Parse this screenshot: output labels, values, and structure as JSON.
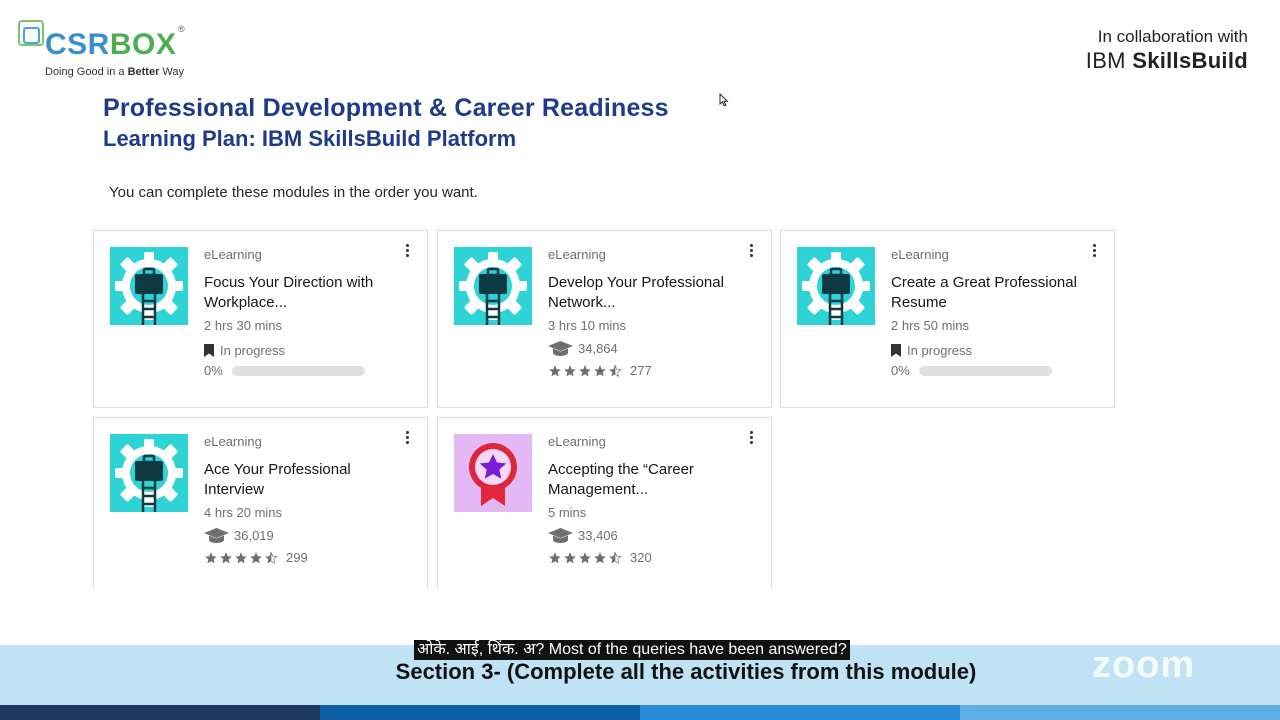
{
  "header": {
    "logo_word_a": "CSR",
    "logo_word_b": "BOX",
    "logo_registered": "®",
    "logo_tagline_pre": "Doing Good in a ",
    "logo_tagline_bold": "Better",
    "logo_tagline_post": " Way",
    "collab_line": "In collaboration with",
    "collab_brand_regular": "IBM ",
    "collab_brand_bold": "SkillsBuild"
  },
  "page": {
    "title": "Professional Development & Career Readiness",
    "subtitle": "Learning Plan: IBM SkillsBuild Platform",
    "intro": "You can complete these modules in the order you want."
  },
  "cards": [
    {
      "type": "eLearning",
      "title": "Focus Your Direction with Workplace...",
      "duration": "2 hrs 30 mins",
      "status": "In progress",
      "progress_label": "0%",
      "progress": 0,
      "thumb": "briefcase-gear-icon"
    },
    {
      "type": "eLearning",
      "title": "Develop Your Professional Network...",
      "duration": "3 hrs 10 mins",
      "learners": "34,864",
      "rating": 4.5,
      "reviews": "277",
      "thumb": "briefcase-gear-icon"
    },
    {
      "type": "eLearning",
      "title": "Create a Great Professional Resume",
      "duration": "2 hrs 50 mins",
      "status": "In progress",
      "progress_label": "0%",
      "progress": 0,
      "thumb": "briefcase-gear-icon"
    },
    {
      "type": "eLearning",
      "title": "Ace Your Professional Interview",
      "duration": "4 hrs 20 mins",
      "learners": "36,019",
      "rating": 4.5,
      "reviews": "299",
      "thumb": "briefcase-gear-icon"
    },
    {
      "type": "eLearning",
      "title": "Accepting the “Career Management...",
      "duration": "5 mins",
      "learners": "33,406",
      "rating": 4.5,
      "reviews": "320",
      "thumb": "star-badge-icon"
    }
  ],
  "zoom": {
    "caption": "ओके. आई, थिंक. अ? Most of the queries have been answered?",
    "section_banner": "Section 3- (Complete all the activities from this module)",
    "brand": "zoom"
  },
  "colors": {
    "title_blue": "#1f3a8a",
    "thumb_teal": "#2ed3d6",
    "badge_purple": "#e4b8f5",
    "band": "#bfe3f4",
    "strip": [
      "#1d3a5c",
      "#0d5fa6",
      "#2a8ad6",
      "#5fb0e6"
    ]
  }
}
